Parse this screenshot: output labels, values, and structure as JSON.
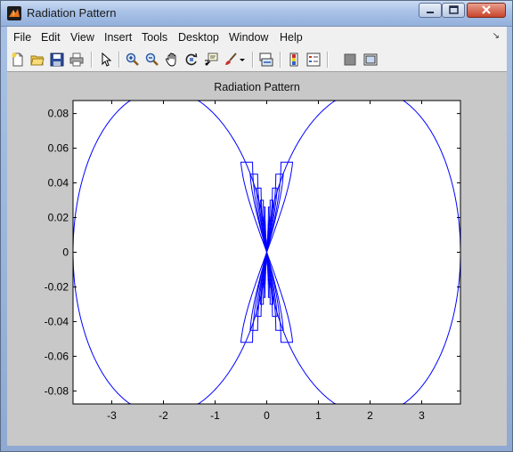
{
  "window": {
    "title": "Radiation Pattern",
    "accent": "#a8c1e6"
  },
  "menu": {
    "items": [
      "File",
      "Edit",
      "View",
      "Insert",
      "Tools",
      "Desktop",
      "Window",
      "Help"
    ]
  },
  "toolbar": {
    "icons": [
      "new-figure-icon",
      "open-file-icon",
      "save-icon",
      "print-icon",
      "edit-plot-icon",
      "zoom-in-icon",
      "zoom-out-icon",
      "pan-icon",
      "rotate-3d-icon",
      "data-cursor-icon",
      "brush-icon",
      "brush-menu-icon",
      "link-plot-icon",
      "insert-colorbar-icon",
      "insert-legend-icon",
      "hide-plot-tools-icon",
      "show-plot-tools-icon"
    ]
  },
  "chart_data": {
    "type": "line",
    "title": "Radiation Pattern",
    "xlabel": "",
    "ylabel": "",
    "xlim": [
      -3.75,
      3.75
    ],
    "ylim": [
      -0.0875,
      0.0875
    ],
    "xticks": [
      "-3",
      "-2",
      "-1",
      "0",
      "1",
      "2",
      "3"
    ],
    "yticks": [
      "0.08",
      "0.06",
      "0.04",
      "0.02",
      "0",
      "-0.02",
      "-0.04",
      "-0.06",
      "-0.08"
    ],
    "grid": false,
    "line_color": "#0000ff",
    "series": [
      {
        "name": "",
        "description_points": {
          "main_lobe_peak_x": [
            -2.35,
            2.35
          ],
          "main_lobe_peak_y": 0.086,
          "main_lobe_extent_x": [
            -3.75,
            3.75
          ],
          "side_lobe_peak_x": [
            -0.5,
            0.5
          ],
          "side_lobe_peak_y": 0.052
        }
      }
    ]
  }
}
